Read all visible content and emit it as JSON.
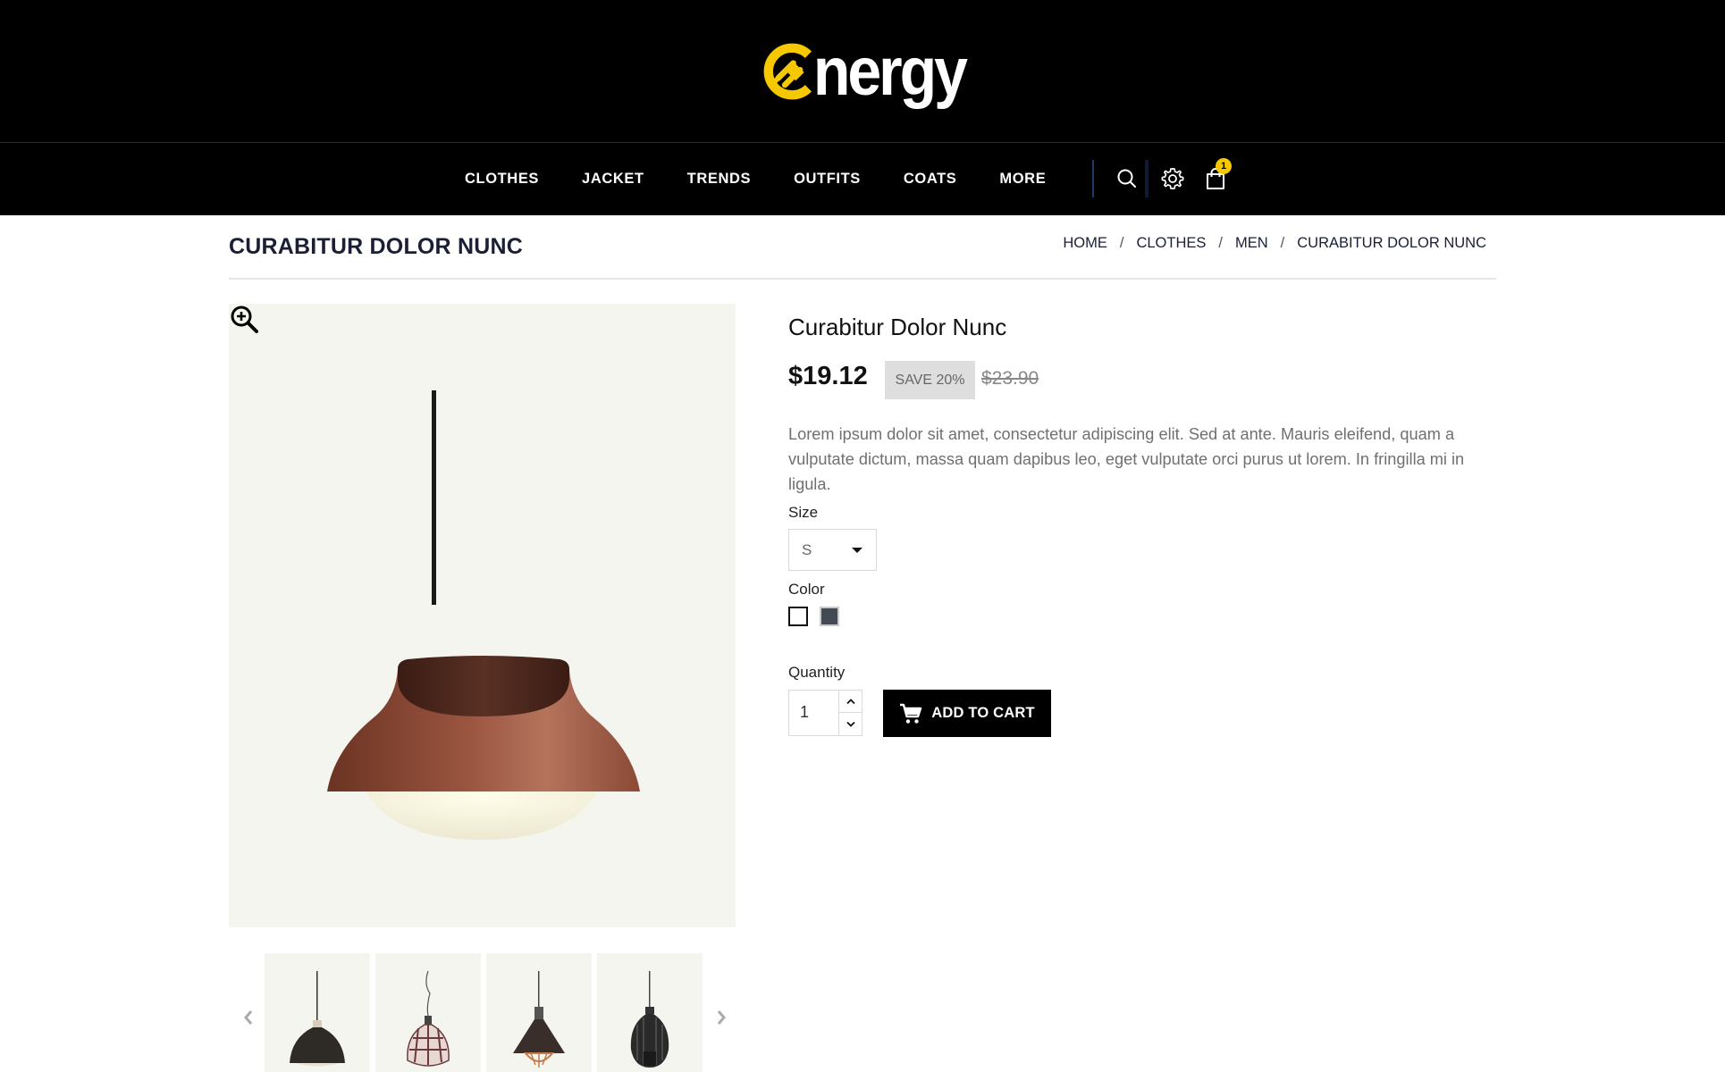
{
  "brand": {
    "logo_text": "nergy",
    "logo_initial": "E",
    "accent_color": "#f5c800"
  },
  "nav": {
    "items": [
      "CLOTHES",
      "JACKET",
      "TRENDS",
      "OUTFITS",
      "COATS",
      "MORE"
    ],
    "icons": [
      "search-icon",
      "gear-icon",
      "shopping-bag-icon"
    ],
    "cart_count": "1"
  },
  "page": {
    "heading": "CURABITUR DOLOR NUNC",
    "breadcrumb": [
      "HOME",
      "CLOTHES",
      "MEN",
      "CURABITUR DOLOR NUNC"
    ],
    "breadcrumb_separator": "/"
  },
  "product": {
    "title": "Curabitur Dolor Nunc",
    "price": "$19.12",
    "discount_label": "SAVE 20%",
    "old_price": "$23.90",
    "description": "Lorem ipsum dolor sit amet, consectetur adipiscing elit. Sed at ante. Mauris eleifend, quam a vulputate dictum, massa quam dapibus leo, eget vulputate orci purus ut lorem. In fringilla mi in ligula.",
    "size_label": "Size",
    "size_selected": "S",
    "color_label": "Color",
    "colors": [
      "#ffffff",
      "#434a54"
    ],
    "quantity_label": "Quantity",
    "quantity_value": "1",
    "add_to_cart_label": "ADD TO CART"
  },
  "gallery": {
    "thumbnail_count": 4,
    "zoom_icon": "zoom-in-icon",
    "prev_icon": "chevron-left-icon",
    "next_icon": "chevron-right-icon"
  }
}
